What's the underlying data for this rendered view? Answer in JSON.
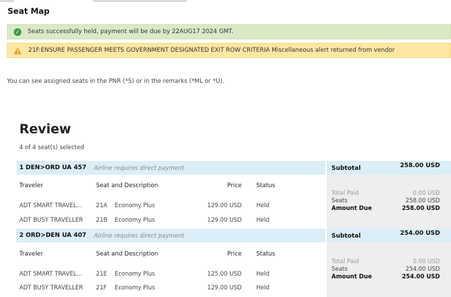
{
  "page": {
    "title": "Seat Map"
  },
  "alerts": {
    "success": "Seats successfully held, payment will be due by 22AUG17 2024 GMT.",
    "warning": "21F:ENSURE PASSENGER MEETS GOVERNMENT DESIGNATED EXIT ROW CRITERIA Miscellaneous alert returned from vendor"
  },
  "info": "You can see assigned seats in the PNR (*S) or in the remarks (*ML or *U).",
  "review": {
    "heading": "Review",
    "count": "4 of 4 seat(s) selected"
  },
  "columns": {
    "traveler": "Traveler",
    "seat": "Seat and Description",
    "price": "Price",
    "status": "Status"
  },
  "totals_labels": {
    "subtotal": "Subtotal",
    "paid": "Total Paid",
    "seats": "Seats",
    "due": "Amount Due"
  },
  "colors": {
    "success_bg": "#dbe9c7",
    "warning_bg": "#fde7a2",
    "segment_header_bg": "#dbeef8",
    "totals_bg": "#eeeeee"
  },
  "segments": [
    {
      "route": "1 DEN>ORD UA 457",
      "note": "Airline requires direct payment",
      "subtotal": "258.00 USD",
      "totals": {
        "paid": "0.00 USD",
        "seats": "258.00 USD",
        "due": "258.00 USD"
      },
      "rows": [
        {
          "traveler": "ADT SMART TRAVEL...",
          "seat": "21A",
          "desc": "Economy Plus",
          "price": "129.00 USD",
          "status": "Held"
        },
        {
          "traveler": "ADT BUSY TRAVELLER",
          "seat": "21B",
          "desc": "Economy Plus",
          "price": "129.00 USD",
          "status": "Held"
        }
      ]
    },
    {
      "route": "2 ORD>DEN UA 407",
      "note": "Airline requires direct payment",
      "subtotal": "254.00 USD",
      "totals": {
        "paid": "0.00 USD",
        "seats": "254.00 USD",
        "due": "254.00 USD"
      },
      "rows": [
        {
          "traveler": "ADT SMART TRAVEL...",
          "seat": "21E",
          "desc": "Economy Plus",
          "price": "125.00 USD",
          "status": "Held"
        },
        {
          "traveler": "ADT BUSY TRAVELLER",
          "seat": "21F",
          "desc": "Economy Plus",
          "price": "129.00 USD",
          "status": "Held"
        }
      ]
    }
  ]
}
